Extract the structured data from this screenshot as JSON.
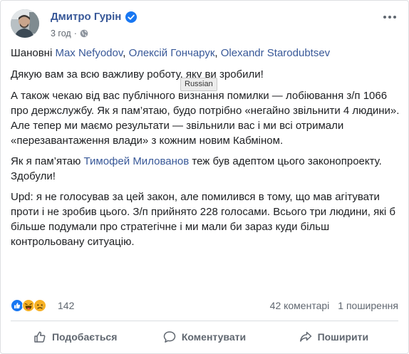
{
  "post": {
    "author": "Дмитро Гурін",
    "time": "3 год",
    "meta_separator": "·",
    "paragraph1": {
      "greeting": "Шановні ",
      "mentions": [
        "Max Nefyodov",
        "Олексій Гончарук",
        "Olexandr Starodubtsev"
      ],
      "sep": ", "
    },
    "paragraph2": "Дякую вам за всю важливу роботу, яку ви зробили!",
    "paragraph3": [
      "А також чекаю від вас публічного визнання помилки — лобіювання з/п 1066 про держслужбу. Як я пам’ятаю, будо потрібно «негайно звільнити 4 людини».",
      "Але тепер ми маємо результати — звільнили вас і ми всі отримали «перезавантаження влади» з кожним новим Кабміном."
    ],
    "paragraph4": {
      "prefix": "Як я пам’ятаю ",
      "mention": "Тимофей Милованов",
      "suffix": " теж був адептом цього законопроекту.",
      "line2": "Здобули!"
    },
    "paragraph5": "Upd: я не голосував за цей закон, але помилився в тому, що мав агітувати проти і не зробив цього. З/п прийнято 228 голосами. Всього три людини, які б більше подумали про стратегічне і ми мали би зараз куди більш контрольовану ситуацію.",
    "tooltip": "Russian"
  },
  "reactions": {
    "icons": [
      "like-icon",
      "haha-icon",
      "sad-icon"
    ],
    "count": "142",
    "comments": "42 коментарі",
    "shares": "1 поширення"
  },
  "actions": {
    "like": "Подобається",
    "comment": "Коментувати",
    "share": "Поширити"
  },
  "colors": {
    "link": "#385898",
    "text": "#1c1e21",
    "muted": "#606770",
    "like_blue": "#1877f2",
    "verified_blue": "#1877f2"
  }
}
